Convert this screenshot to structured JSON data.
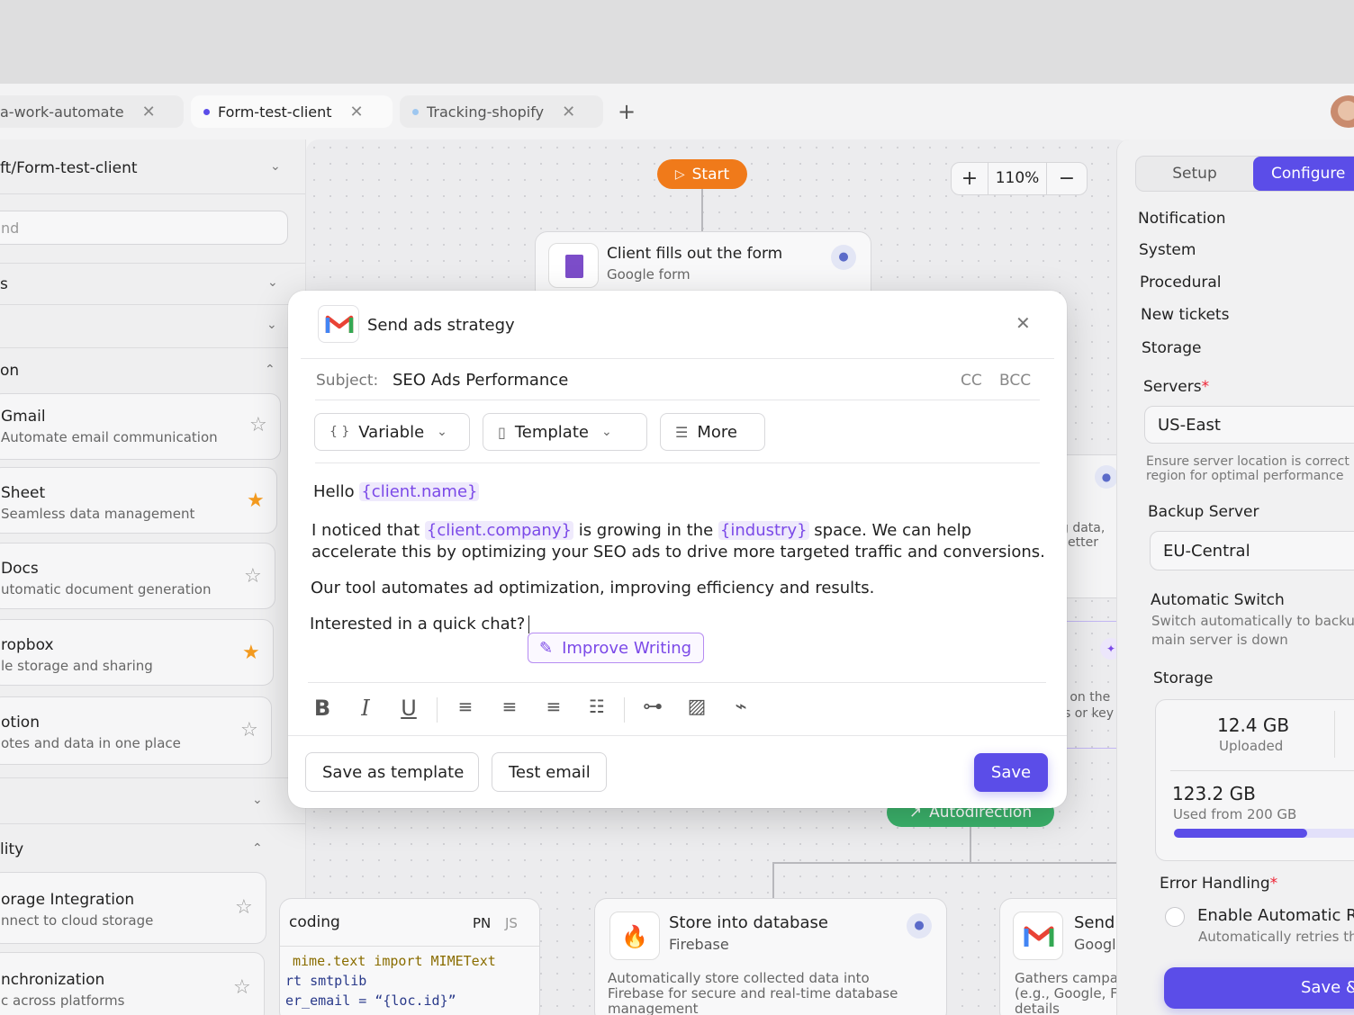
{
  "tabs": [
    {
      "label": "a-work-automate",
      "dot": ""
    },
    {
      "label": "Form-test-client",
      "dot": "#5b4de8"
    },
    {
      "label": "Tracking-shopify",
      "dot": "#9ec7f0"
    }
  ],
  "tab_add": "+",
  "sidebar": {
    "path": "ft/Form-test-client",
    "search_placeholder": "nd",
    "section1": "s",
    "section_on": "on",
    "section_lity": "lity",
    "cards": [
      {
        "title": "Gmail",
        "desc": "Automate email communication",
        "fav": false
      },
      {
        "title": "Sheet",
        "desc": "Seamless data management",
        "fav": true
      },
      {
        "title": "Docs",
        "desc": "utomatic document generation",
        "fav": false
      },
      {
        "title": "ropbox",
        "desc": "le storage and sharing",
        "fav": true
      },
      {
        "title": "otion",
        "desc": "otes and data in one place",
        "fav": false
      }
    ],
    "cards2": [
      {
        "title": "orage Integration",
        "desc": "nnect to cloud storage"
      },
      {
        "title": "nchronization",
        "desc": "c across platforms"
      }
    ]
  },
  "canvas": {
    "start": "Start",
    "zoom": "110%",
    "zoom_in": "+",
    "zoom_out": "−",
    "form_node": {
      "title": "Client fills out the form",
      "sub": "Google form"
    },
    "frag1": "g data,",
    "frag2": "etter",
    "frag3": "l on the",
    "frag4": "s or key",
    "autodirection": "Autodirection",
    "code_node": {
      "title": "coding",
      "lang1": "PN",
      "lang2": "JS",
      "lines": [
        "mime.text import MIMEText",
        "rt smtplib",
        "er_email = “{loc.id}”"
      ]
    },
    "db_node": {
      "title": "Store into database",
      "sub": "Firebase",
      "desc1": "Automatically store collected data into",
      "desc2": "Firebase for secure and real-time database",
      "desc3": "management"
    },
    "send_node": {
      "title": "Send ad",
      "sub": "Google",
      "desc1": "Gathers campaig",
      "desc2": "(e.g., Google, Fac",
      "desc3": "details"
    }
  },
  "right": {
    "tabs": {
      "setup": "Setup",
      "configure": "Configure"
    },
    "menu": [
      "Notification",
      "System",
      "Procedural",
      "New tickets",
      "Storage"
    ],
    "servers_label": "Servers",
    "servers_value": "US-East",
    "servers_hint1": "Ensure server location is correct",
    "servers_hint2": "region for optimal performance",
    "backup_label": "Backup Server",
    "backup_value": "EU-Central",
    "auto_label": "Automatic Switch",
    "auto_hint1": "Switch automatically to backu",
    "auto_hint2": "main server is down",
    "storage_label": "Storage",
    "uploaded_value": "12.4 GB",
    "uploaded_label": "Uploaded",
    "used_value": "123.2 GB",
    "used_label": "Used from 200 GB",
    "used_fraction": 0.616,
    "error_label": "Error Handling",
    "enable_label": "Enable Automatic R",
    "enable_hint": "Automatically retries th",
    "save_btn": "Save &"
  },
  "modal": {
    "title": "Send ads strategy",
    "subject_label": "Subject:",
    "subject_value": "SEO Ads Performance",
    "cc": "CC",
    "bcc": "BCC",
    "toolbar": {
      "variable": "Variable",
      "template": "Template",
      "more": "More"
    },
    "body": {
      "hello": "Hello",
      "tok_name": "{client.name}",
      "l2a": "I noticed that",
      "tok_company": "{client.company}",
      "l2b": "is growing in the",
      "tok_industry": "{industry}",
      "l2c": "space. We can help",
      "l3": "accelerate this by optimizing your SEO ads to drive more targeted traffic and conversions.",
      "l4": "Our tool automates ad optimization, improving efficiency and results.",
      "l5": "Interested in a quick chat?"
    },
    "improve": "Improve Writing",
    "save_template": "Save as template",
    "test_email": "Test email",
    "save": "Save"
  },
  "colors": {
    "accent": "#5b4de8",
    "start": "#f07a1a",
    "green": "#3bb26b"
  }
}
